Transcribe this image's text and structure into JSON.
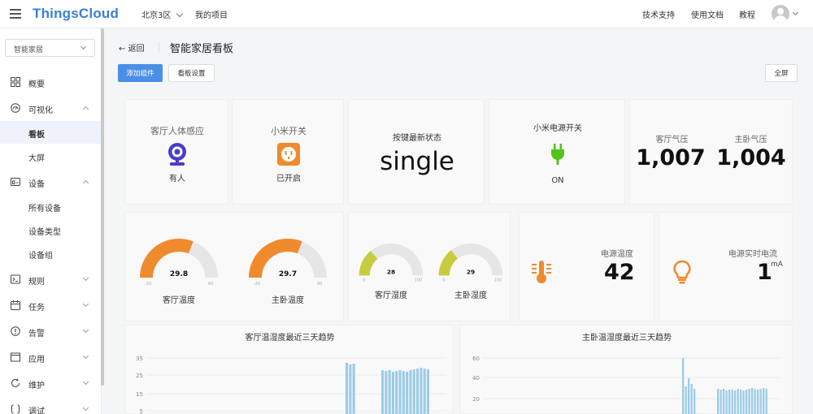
{
  "app": {
    "logo": "ThingsCloud",
    "region": "北京3区",
    "project_link": "我的项目"
  },
  "header_links": [
    "技术支持",
    "使用文档",
    "教程"
  ],
  "sidebar": {
    "project_select": "智能家居",
    "items": [
      {
        "label": "概要",
        "icon": "grid-icon"
      },
      {
        "label": "可视化",
        "icon": "dashboard-icon"
      },
      {
        "label": "看板",
        "sub": true,
        "active": true
      },
      {
        "label": "大屏",
        "sub": true
      },
      {
        "label": "设备",
        "icon": "device-icon"
      },
      {
        "label": "所有设备",
        "sub": true
      },
      {
        "label": "设备类型",
        "sub": true
      },
      {
        "label": "设备组",
        "sub": true
      },
      {
        "label": "规则",
        "icon": "terminal-icon"
      },
      {
        "label": "任务",
        "icon": "calendar-icon"
      },
      {
        "label": "告警",
        "icon": "alert-icon"
      },
      {
        "label": "应用",
        "icon": "window-icon"
      },
      {
        "label": "维护",
        "icon": "refresh-icon"
      },
      {
        "label": "调试",
        "icon": "braces-icon"
      }
    ]
  },
  "page": {
    "back": "返回",
    "title": "智能家居看板",
    "add_widget": "添加组件",
    "board_settings": "看板设置",
    "fullscreen": "全屏"
  },
  "widgets": {
    "motion": {
      "title": "客厅人体感应",
      "status": "有人"
    },
    "switch": {
      "title": "小米开关",
      "status": "已开启"
    },
    "button": {
      "title": "按键最新状态",
      "value": "single"
    },
    "power_switch": {
      "title": "小米电源开关",
      "status": "ON"
    },
    "pressure_living": {
      "title": "客厅气压",
      "value": "1,007"
    },
    "pressure_master": {
      "title": "主卧气压",
      "value": "1,004"
    },
    "gauge_temp_living": {
      "label": "客厅温度",
      "value": "29.8",
      "min": "-20",
      "max": "60",
      "fraction": 0.62
    },
    "gauge_temp_master": {
      "label": "主卧温度",
      "value": "29.7",
      "min": "-20",
      "max": "60",
      "fraction": 0.62
    },
    "gauge_hum_living": {
      "label": "客厅湿度",
      "value": "28",
      "min": "0",
      "max": "100",
      "fraction": 0.28
    },
    "gauge_hum_master": {
      "label": "主卧湿度",
      "value": "29",
      "min": "0",
      "max": "100",
      "fraction": 0.29
    },
    "power_temp": {
      "title": "电源温度",
      "value": "42"
    },
    "power_current": {
      "title": "电源实时电流",
      "value": "1",
      "unit": "mA"
    }
  },
  "charts": {
    "living": {
      "title": "客厅温湿度最近三天趋势",
      "ticks": [
        "35",
        "25",
        "15",
        "5"
      ]
    },
    "master": {
      "title": "主卧温湿度最近三天趋势",
      "ticks": [
        "60",
        "40",
        "20"
      ]
    }
  },
  "colors": {
    "accent": "#4a8fe5",
    "orange": "#ef8a2d",
    "yellow_green": "#c8cc3f",
    "green": "#52c41a",
    "purple": "#4b3cc9"
  }
}
